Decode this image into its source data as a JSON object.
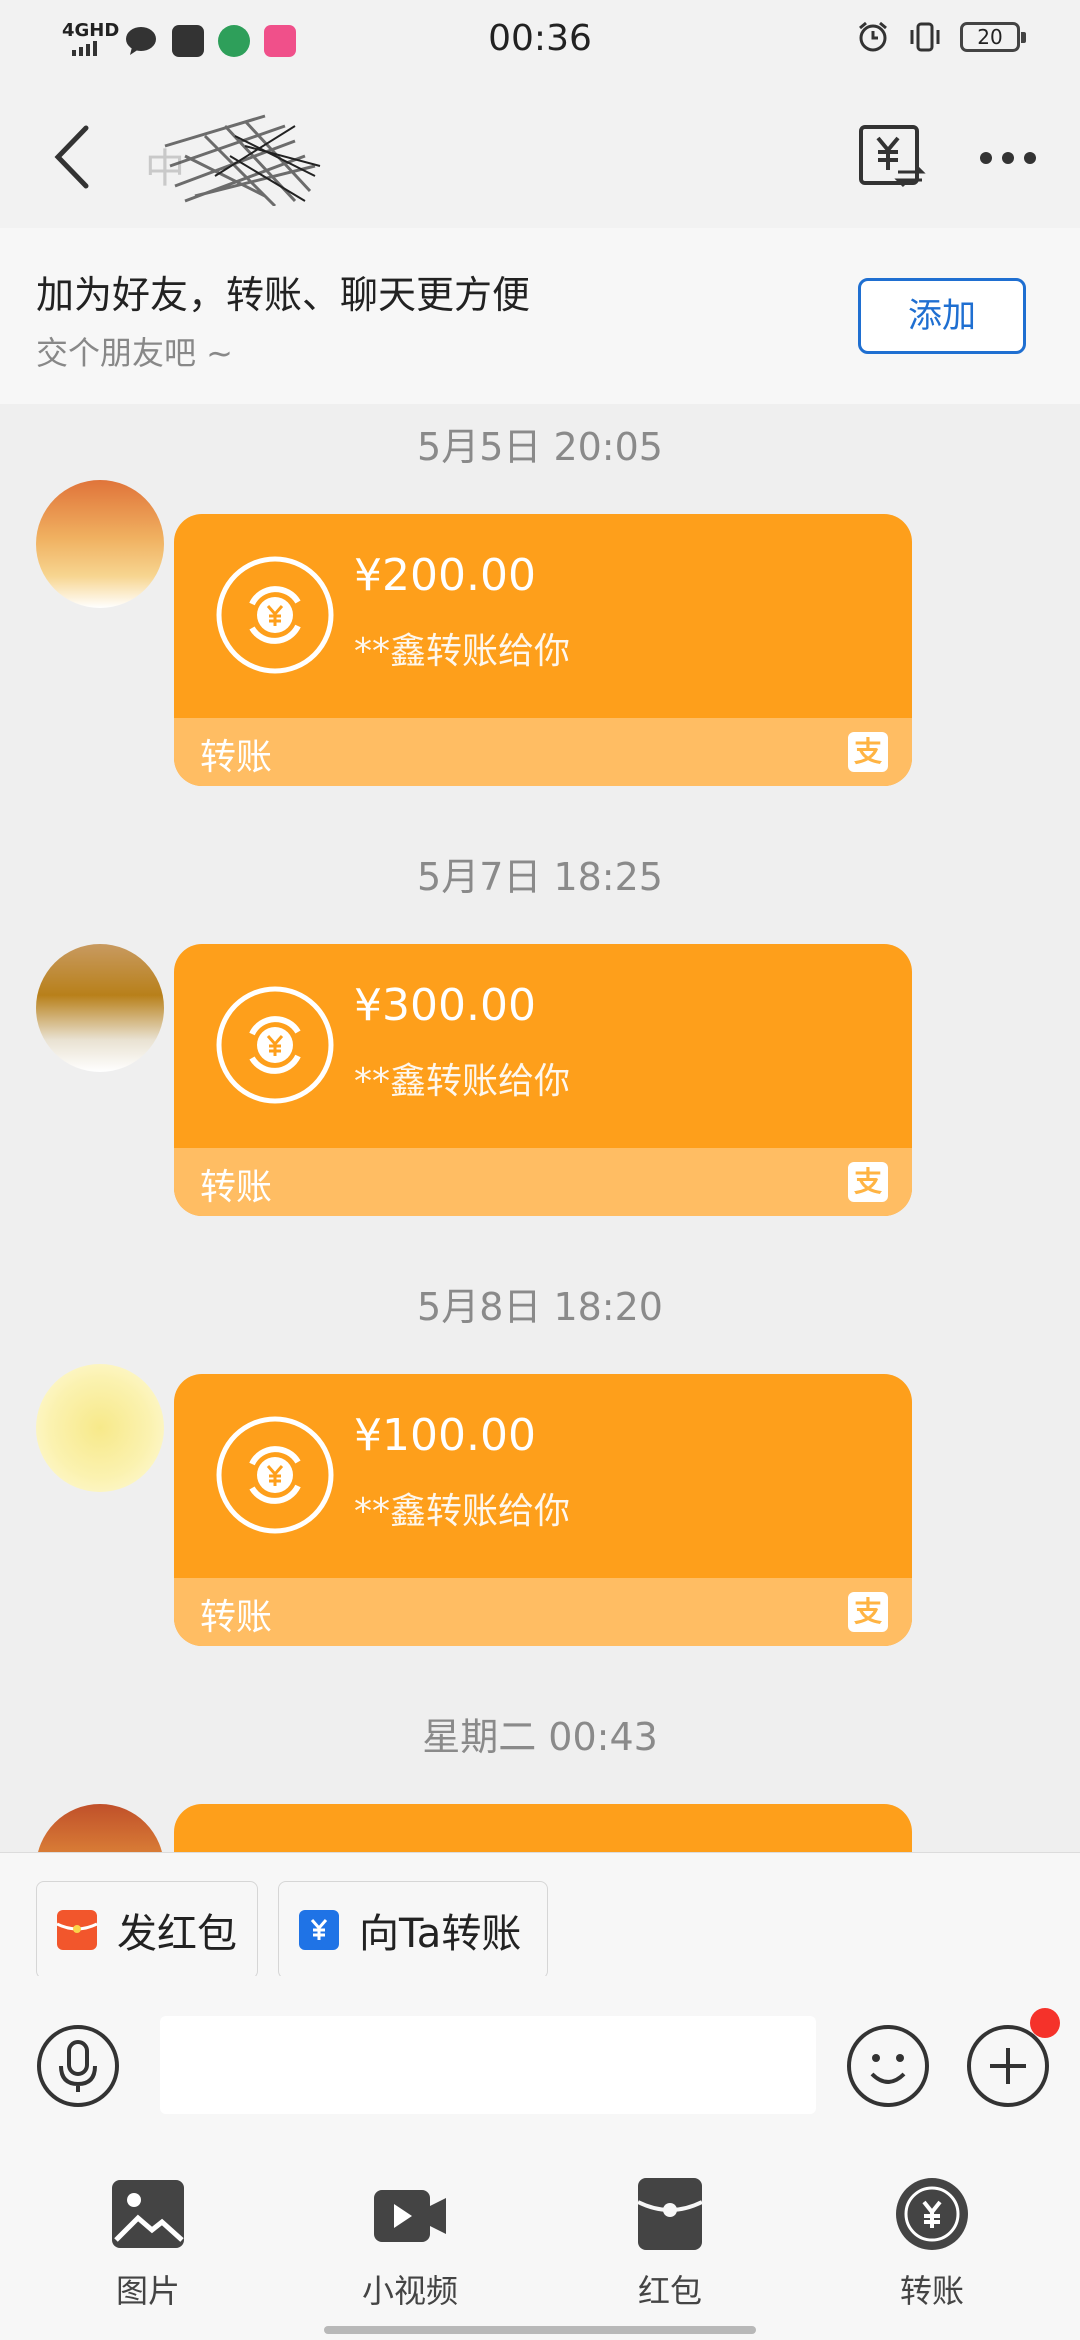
{
  "status_bar": {
    "network": "4GHD",
    "time": "00:36",
    "battery": "20"
  },
  "header": {
    "contact_name": "中",
    "transfer_icon": "yuan-transfer-icon",
    "more_icon": "ellipsis-icon"
  },
  "friend_banner": {
    "title": "加为好友，转账、聊天更方便",
    "subtitle": "交个朋友吧 ~",
    "add_button": "添加"
  },
  "messages": [
    {
      "timestamp": "5月5日 20:05",
      "amount": "¥200.00",
      "description": "**鑫转账给你",
      "footer": "转账",
      "badge": "支"
    },
    {
      "timestamp": "5月7日 18:25",
      "amount": "¥300.00",
      "description": "**鑫转账给你",
      "footer": "转账",
      "badge": "支"
    },
    {
      "timestamp": "5月8日 18:20",
      "amount": "¥100.00",
      "description": "**鑫转账给你",
      "footer": "转账",
      "badge": "支"
    },
    {
      "timestamp": "星期二 00:43",
      "amount": "",
      "description": "",
      "footer": "",
      "badge": ""
    }
  ],
  "quick_actions": {
    "red_packet": "发红包",
    "transfer_to": "向Ta转账"
  },
  "input": {
    "value": ""
  },
  "panel": {
    "photo": "图片",
    "video": "小视频",
    "red_packet": "红包",
    "transfer": "转账"
  },
  "colors": {
    "card": "#fe9f1b",
    "card_footer": "#ffbd63",
    "link_blue": "#1f6fd1",
    "badge_red": "#f5322a"
  }
}
